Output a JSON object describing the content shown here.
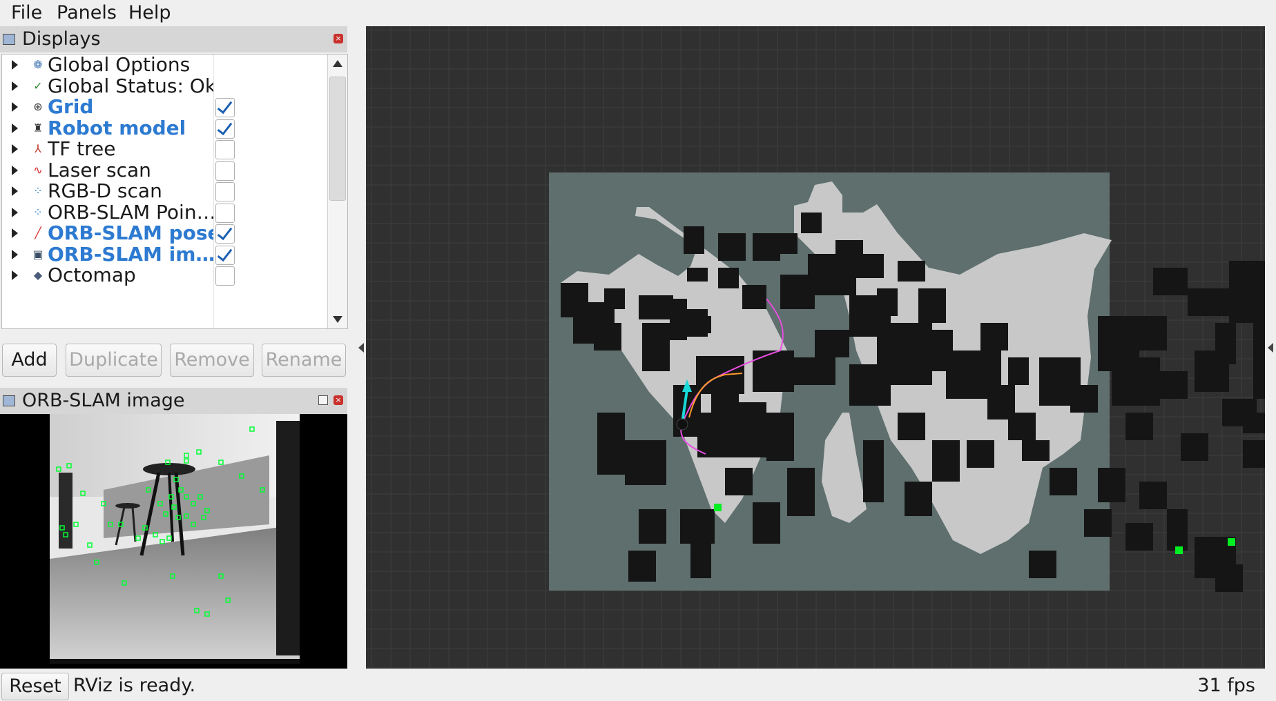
{
  "menu": {
    "file": "File",
    "panels": "Panels",
    "help": "Help"
  },
  "displays_panel": {
    "title": "Displays",
    "items": [
      {
        "label": "Global Options",
        "icon": "gear-icon",
        "glyph": "❁",
        "color": "#3a6fb0",
        "checkbox": false
      },
      {
        "label": "Global Status: Ok",
        "icon": "check-icon",
        "glyph": "✓",
        "color": "#2e8b2e",
        "checkbox": false
      },
      {
        "label": "Grid",
        "icon": "grid-icon",
        "glyph": "⊕",
        "color": "#444444",
        "checkbox": true,
        "checked": true,
        "active": true
      },
      {
        "label": "Robot model",
        "icon": "robot-icon",
        "glyph": "♜",
        "color": "#333333",
        "checkbox": true,
        "checked": true,
        "active": true
      },
      {
        "label": "TF tree",
        "icon": "axes-icon",
        "glyph": "⅄",
        "color": "#c0392b",
        "checkbox": true,
        "checked": false
      },
      {
        "label": "Laser scan",
        "icon": "laser-icon",
        "glyph": "∿",
        "color": "#d62828",
        "checkbox": true,
        "checked": false
      },
      {
        "label": "RGB-D scan",
        "icon": "pointcloud-icon",
        "glyph": "⁘",
        "color": "#3a86c8",
        "checkbox": true,
        "checked": false
      },
      {
        "label": "ORB-SLAM Poin…",
        "icon": "pointcloud-icon",
        "glyph": "⁘",
        "color": "#3a86c8",
        "checkbox": true,
        "checked": false
      },
      {
        "label": "ORB-SLAM pose",
        "icon": "pose-icon",
        "glyph": "╱",
        "color": "#d62828",
        "checkbox": true,
        "checked": true,
        "active": true
      },
      {
        "label": "ORB-SLAM im…",
        "icon": "image-icon",
        "glyph": "▣",
        "color": "#3c4e66",
        "checkbox": true,
        "checked": true,
        "active": true
      },
      {
        "label": "Octomap",
        "icon": "octomap-icon",
        "glyph": "◆",
        "color": "#4b5d7a",
        "checkbox": true,
        "checked": false
      }
    ]
  },
  "buttons": {
    "add": "Add",
    "duplicate": "Duplicate",
    "remove": "Remove",
    "rename": "Rename"
  },
  "image_panel": {
    "title": "ORB-SLAM image"
  },
  "status": {
    "reset": "Reset",
    "message": "RViz is ready.",
    "fps": "31 fps"
  },
  "colors": {
    "background": "#303030",
    "grid_line": "#3c3c3c",
    "map_unknown": "#5e6f6d",
    "map_free": "#c8c8c8",
    "map_occupied": "#151515",
    "feature": "#00ff33",
    "path_magenta": "#e84de0",
    "path_orange": "#ff9a2a",
    "pose_arrow": "#18d8d8",
    "active_label": "#2d7ad1"
  }
}
